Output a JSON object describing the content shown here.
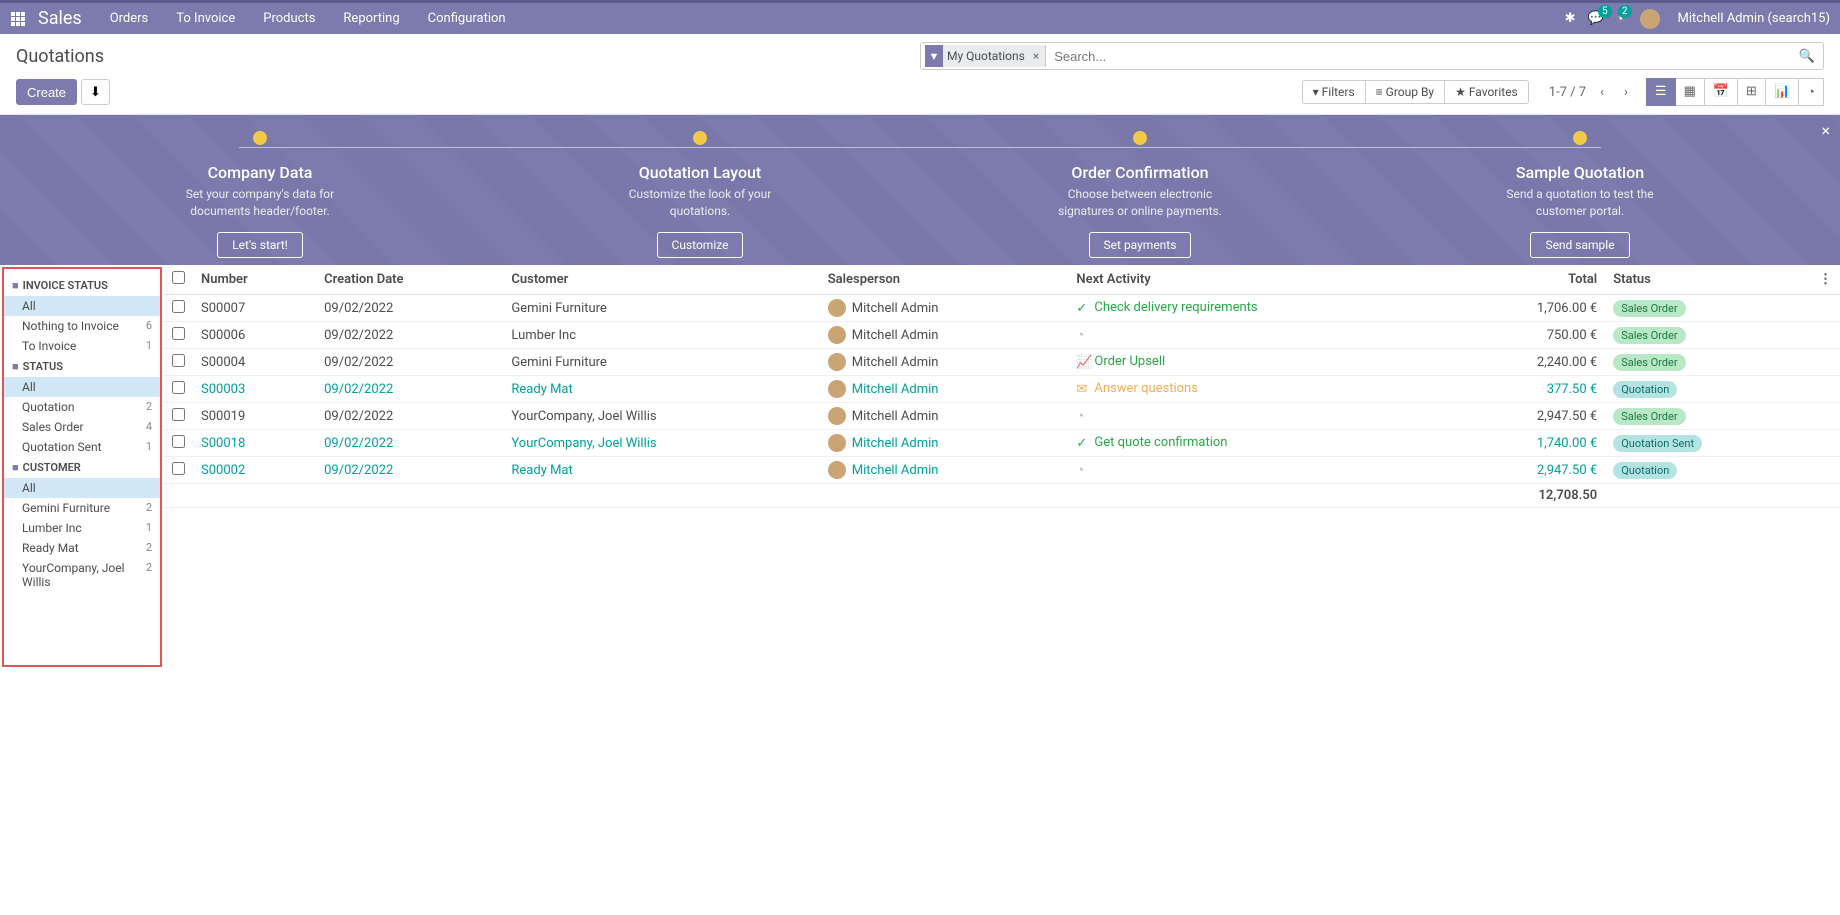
{
  "navbar": {
    "brand": "Sales",
    "menu": [
      "Orders",
      "To Invoice",
      "Products",
      "Reporting",
      "Configuration"
    ],
    "msg_badge": "5",
    "activity_badge": "2",
    "user": "Mitchell Admin (search15)"
  },
  "breadcrumb": "Quotations",
  "search": {
    "facet": "My Quotations",
    "placeholder": "Search..."
  },
  "buttons": {
    "create": "Create"
  },
  "search_opts": {
    "filters": "Filters",
    "groupby": "Group By",
    "favorites": "Favorites"
  },
  "pager": "1-7 / 7",
  "onboarding": {
    "steps": [
      {
        "title": "Company Data",
        "desc": "Set your company's data for documents header/footer.",
        "btn": "Let's start!"
      },
      {
        "title": "Quotation Layout",
        "desc": "Customize the look of your quotations.",
        "btn": "Customize"
      },
      {
        "title": "Order Confirmation",
        "desc": "Choose between electronic signatures or online payments.",
        "btn": "Set payments"
      },
      {
        "title": "Sample Quotation",
        "desc": "Send a quotation to test the customer portal.",
        "btn": "Send sample"
      }
    ]
  },
  "sidebar": {
    "groups": [
      {
        "title": "INVOICE STATUS",
        "items": [
          {
            "label": "All",
            "count": "",
            "active": true
          },
          {
            "label": "Nothing to Invoice",
            "count": "6"
          },
          {
            "label": "To Invoice",
            "count": "1"
          }
        ]
      },
      {
        "title": "STATUS",
        "items": [
          {
            "label": "All",
            "count": "",
            "active": true
          },
          {
            "label": "Quotation",
            "count": "2"
          },
          {
            "label": "Sales Order",
            "count": "4"
          },
          {
            "label": "Quotation Sent",
            "count": "1"
          }
        ]
      },
      {
        "title": "CUSTOMER",
        "items": [
          {
            "label": "All",
            "count": "",
            "active": true
          },
          {
            "label": "Gemini Furniture",
            "count": "2"
          },
          {
            "label": "Lumber Inc",
            "count": "1"
          },
          {
            "label": "Ready Mat",
            "count": "2"
          },
          {
            "label": "YourCompany, Joel Willis",
            "count": "2"
          }
        ]
      }
    ]
  },
  "columns": [
    "Number",
    "Creation Date",
    "Customer",
    "Salesperson",
    "Next Activity",
    "Total",
    "Status"
  ],
  "rows": [
    {
      "num": "S00007",
      "date": "09/02/2022",
      "customer": "Gemini Furniture",
      "sales": "Mitchell Admin",
      "activity": "Check delivery requirements",
      "act_type": "planned",
      "act_icon": "check",
      "total": "1,706.00 €",
      "status": "Sales Order",
      "pill": "green",
      "link": false
    },
    {
      "num": "S00006",
      "date": "09/02/2022",
      "customer": "Lumber Inc",
      "sales": "Mitchell Admin",
      "activity": "",
      "act_type": "none",
      "act_icon": "clock",
      "total": "750.00 €",
      "status": "Sales Order",
      "pill": "green",
      "link": false
    },
    {
      "num": "S00004",
      "date": "09/02/2022",
      "customer": "Gemini Furniture",
      "sales": "Mitchell Admin",
      "activity": "Order Upsell",
      "act_type": "planned",
      "act_icon": "chart",
      "total": "2,240.00 €",
      "status": "Sales Order",
      "pill": "green",
      "link": false
    },
    {
      "num": "S00003",
      "date": "09/02/2022",
      "customer": "Ready Mat",
      "sales": "Mitchell Admin",
      "activity": "Answer questions",
      "act_type": "today",
      "act_icon": "mail",
      "total": "377.50 €",
      "status": "Quotation",
      "pill": "teal",
      "link": true
    },
    {
      "num": "S00019",
      "date": "09/02/2022",
      "customer": "YourCompany, Joel Willis",
      "sales": "Mitchell Admin",
      "activity": "",
      "act_type": "none",
      "act_icon": "clock",
      "total": "2,947.50 €",
      "status": "Sales Order",
      "pill": "green",
      "link": false
    },
    {
      "num": "S00018",
      "date": "09/02/2022",
      "customer": "YourCompany, Joel Willis",
      "sales": "Mitchell Admin",
      "activity": "Get quote confirmation",
      "act_type": "planned",
      "act_icon": "check",
      "total": "1,740.00 €",
      "status": "Quotation Sent",
      "pill": "teal",
      "link": true
    },
    {
      "num": "S00002",
      "date": "09/02/2022",
      "customer": "Ready Mat",
      "sales": "Mitchell Admin",
      "activity": "",
      "act_type": "none",
      "act_icon": "clock",
      "total": "2,947.50 €",
      "status": "Quotation",
      "pill": "teal",
      "link": true
    }
  ],
  "footer_total": "12,708.50"
}
